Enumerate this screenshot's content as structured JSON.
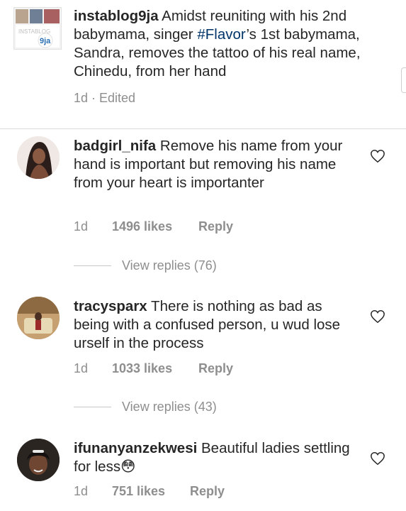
{
  "caption": {
    "username": "instablog9ja",
    "text_before": " Amidst reuniting with his 2nd babymama, singer ",
    "hashtag": "#Flavor",
    "text_after": "’s 1st babymama, Sandra, removes the tattoo of his real name, Chinedu, from her hand",
    "time": "1d",
    "separator": " · ",
    "edited": "Edited",
    "avatar_text_top": "INSTABLOG",
    "avatar_text_bottom": "9ja"
  },
  "comments": [
    {
      "username": "badgirl_nifa",
      "text": " Remove his name from your hand is important but removing his name from your heart is importanter",
      "time": "1d",
      "likes": "1496 likes",
      "reply": "Reply",
      "view_replies": "View replies (76)"
    },
    {
      "username": "tracysparx",
      "text": " There is nothing as bad as being with a confused person, u wud lose urself in the process",
      "time": "1d",
      "likes": "1033 likes",
      "reply": "Reply",
      "view_replies": "View replies (43)"
    },
    {
      "username": "ifunanyanzekwesi",
      "text": " Beautiful ladies settling for less😳",
      "time": "1d",
      "likes": "751 likes",
      "reply": "Reply"
    }
  ],
  "colors": {
    "text": "#262626",
    "muted": "#8e8e8e",
    "hashtag": "#003569",
    "divider": "#dbdbdb"
  },
  "icons": {
    "like": "heart-outline-icon"
  }
}
